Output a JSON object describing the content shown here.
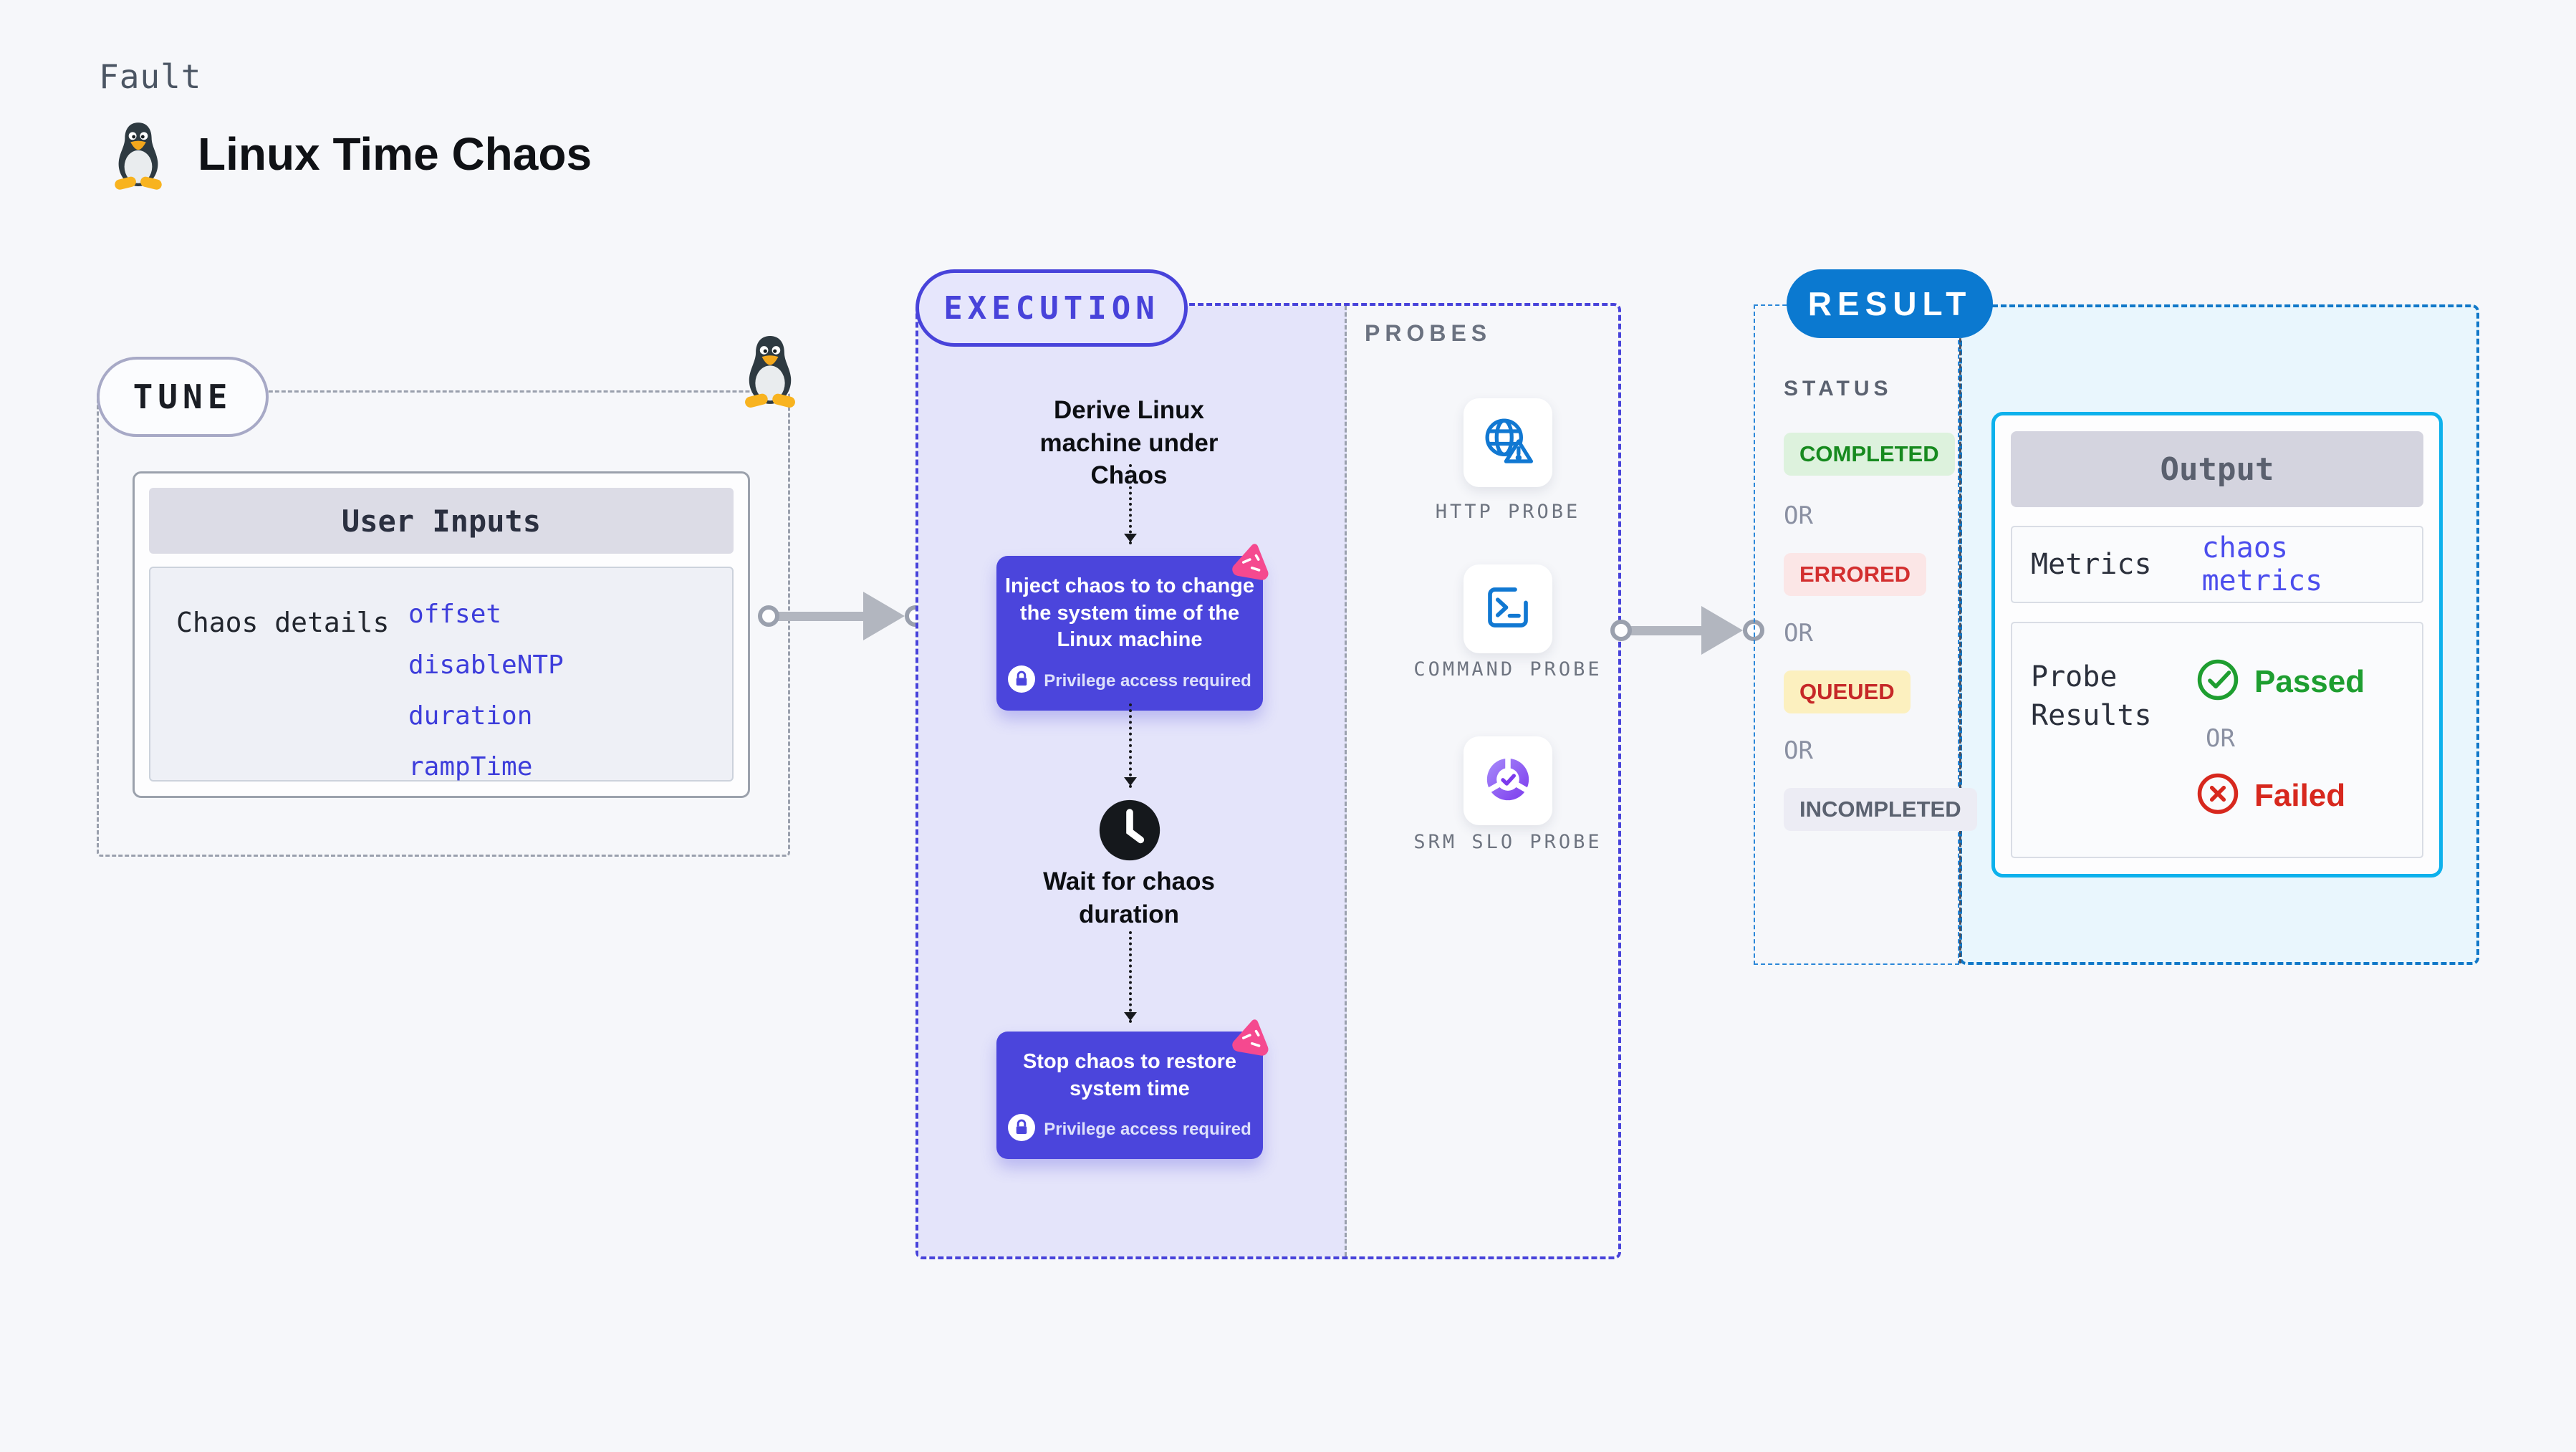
{
  "page": {
    "eyebrow": "Fault",
    "title": "Linux Time Chaos"
  },
  "tune": {
    "badge": "TUNE",
    "user_inputs": {
      "title": "User Inputs",
      "row_label": "Chaos details",
      "params": [
        "offset",
        "disableNTP",
        "duration",
        "rampTime"
      ]
    }
  },
  "execution": {
    "badge": "EXECUTION",
    "derive_text": "Derive Linux machine under Chaos",
    "inject": {
      "text": "Inject chaos to to change the system time of the Linux machine",
      "privilege": "Privilege access required"
    },
    "wait_text": "Wait for chaos duration",
    "stop": {
      "text": "Stop chaos to restore system time",
      "privilege": "Privilege access required"
    }
  },
  "probes": {
    "title": "PROBES",
    "items": [
      {
        "label": "HTTP PROBE",
        "icon": "globe-alert-icon"
      },
      {
        "label": "COMMAND PROBE",
        "icon": "terminal-icon"
      },
      {
        "label": "SRM SLO PROBE",
        "icon": "slo-donut-icon"
      }
    ]
  },
  "result": {
    "badge": "RESULT",
    "status": {
      "title": "STATUS",
      "or": "OR",
      "states": [
        {
          "label": "COMPLETED",
          "bg": "#ddf2dd",
          "color": "#178a1f"
        },
        {
          "label": "ERRORED",
          "bg": "#fbe6e6",
          "color": "#d32f2f"
        },
        {
          "label": "QUEUED",
          "bg": "#fcf0bf",
          "color": "#c62828"
        },
        {
          "label": "INCOMPLETED",
          "bg": "#ececf4",
          "color": "#5b6270"
        }
      ]
    },
    "output": {
      "title": "Output",
      "metrics_label": "Metrics",
      "metrics_value": "chaos metrics",
      "probe_results_label": "Probe Results",
      "passed": "Passed",
      "or": "OR",
      "failed": "Failed"
    }
  },
  "colors": {
    "accent_indigo": "#4843da",
    "accent_blue": "#0b79d0",
    "lavender_fill": "#e4e4fa",
    "cyan_fill": "#e9f6fd",
    "output_border": "#0db1ec",
    "chaos_pink": "#f5498f",
    "link_blue": "#3d3ddb",
    "green": "#1e9e30",
    "red": "#d32f2f"
  }
}
